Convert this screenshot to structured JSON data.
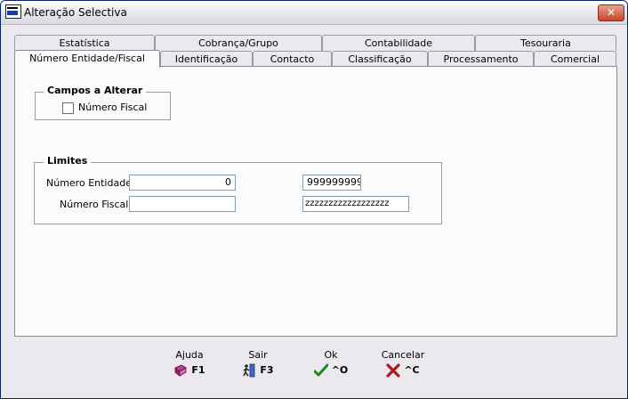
{
  "window": {
    "title": "Alteração Selectiva",
    "close_label": "✕"
  },
  "tabs_back": [
    {
      "label": "Estatística"
    },
    {
      "label": "Cobrança/Grupo"
    },
    {
      "label": "Contabilidade"
    },
    {
      "label": "Tesouraria"
    }
  ],
  "tabs_front": [
    {
      "label": "Número Entidade/Fiscal",
      "active": true
    },
    {
      "label": "Identificação"
    },
    {
      "label": "Contacto"
    },
    {
      "label": "Classificação"
    },
    {
      "label": "Processamento"
    },
    {
      "label": "Comercial"
    }
  ],
  "campos": {
    "title": "Campos a Alterar",
    "numero_fiscal_label": "Número Fiscal",
    "numero_fiscal_checked": false
  },
  "limites": {
    "title": "Limites",
    "numero_entidade_label": "Número Entidade",
    "numero_entidade_from": "0",
    "numero_entidade_to": "999999999",
    "numero_fiscal_label": "Número Fiscal",
    "numero_fiscal_from": "",
    "numero_fiscal_to": "zzzzzzzzzzzzzzzzzz"
  },
  "buttons": {
    "help_caption": "Ajuda",
    "help_key": "F1",
    "exit_caption": "Sair",
    "exit_key": "F3",
    "ok_caption": "Ok",
    "ok_key": "^O",
    "cancel_caption": "Cancelar",
    "cancel_key": "^C"
  }
}
